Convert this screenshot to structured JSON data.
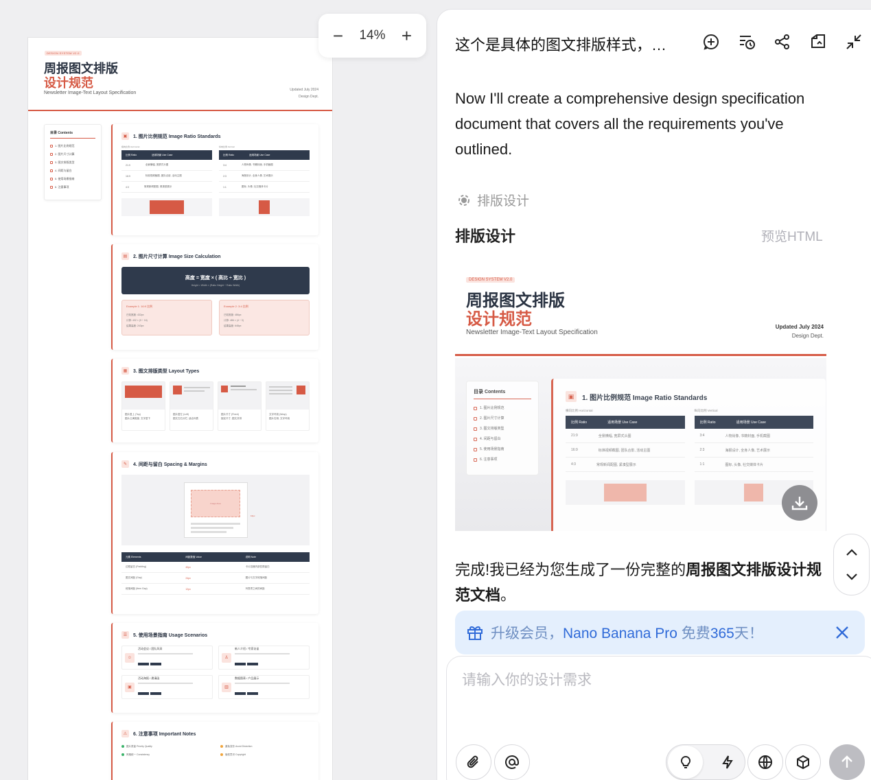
{
  "colors": {
    "accent": "#d65a45",
    "navy": "#2f3a4c",
    "link": "#2f6ad8"
  },
  "canvas": {
    "zoom": {
      "minus": "−",
      "value": "14%",
      "plus": "+"
    },
    "doc": {
      "badge": "DESIGN SYSTEM V2.0",
      "title_line1": "周报图文排版",
      "title_line2": "设计规范",
      "subtitle": "Newsletter Image-Text Layout Specification",
      "updated": "Updated July 2024",
      "dept": "Design Dept.",
      "toc_title": "目录 Contents",
      "toc_items": [
        "1. 图片比例规范",
        "2. 图片尺寸计算",
        "3. 图文排版类型",
        "4. 间距与留白",
        "5. 使用场景指南",
        "6. 注意事项"
      ],
      "sections": [
        {
          "title": "1. 图片比例规范 Image Ratio Standards",
          "icon": "image-icon"
        },
        {
          "title": "2. 图片尺寸计算 Image Size Calculation",
          "icon": "calculator-icon"
        },
        {
          "title": "3. 图文排版类型 Layout Types",
          "icon": "layout-icon"
        },
        {
          "title": "4. 间距与留白 Spacing & Margins",
          "icon": "ruler-icon"
        },
        {
          "title": "5. 使用场景指南 Usage Scenarios",
          "icon": "list-icon"
        },
        {
          "title": "6. 注意事项 Important Notes",
          "icon": "warning-icon"
        }
      ],
      "s1": {
        "h_caption": "横向比例 Horizontal",
        "v_caption": "纵向比例 Vertical",
        "col1": "比例 Ratio",
        "col2": "适用场景 Use Case",
        "h_rows": [
          [
            "21:9",
            "全景横幅, 宽屏式头图"
          ],
          [
            "16:9",
            "标准视频截图, 团队合影, 活动主图"
          ],
          [
            "4:3",
            "常规新闻配图, 紧凑型展示"
          ]
        ],
        "v_rows": [
          [
            "3:4",
            "人物肖像, 书籍封面, 手机截图"
          ],
          [
            "2:3",
            "海报设计, 全身人像, 艺术展示"
          ],
          [
            "1:1",
            "图标, 头像, 社交媒体卡片"
          ]
        ]
      },
      "s2": {
        "formula": "高度 = 宽度 × ( 高比 ÷ 宽比 )",
        "formula_hl": "高比 ÷ 宽比",
        "formula_en": "Height = Width × (Ratio Height ÷ Ratio Width)",
        "ex1_title": "Example 1: 16:9 比例",
        "ex1_lines": [
          "已知宽度: 432px",
          "计算: 432 × (9 ÷ 16)",
          "结果高度: 243px"
        ],
        "ex2_title": "Example 2: 3:4 比例",
        "ex2_lines": [
          "已知宽度: 486px",
          "计算: 486 × (4 ÷ 3)",
          "结果高度: 648px"
        ]
      },
      "s3": {
        "types": [
          {
            "name": "图片居上 (Top)",
            "desc": "图片占满宽度, 文字居下"
          },
          {
            "name": "图片居左 (Left)",
            "desc": "图文左右分栏, 适合列表"
          },
          {
            "name": "图片尺寸 (Fixed)",
            "desc": "固定尺寸, 图文并排"
          },
          {
            "name": "文字环绕 (Wrap)",
            "desc": "图片右侧, 文字环绕"
          }
        ]
      },
      "s4": {
        "image_area": "Image Area",
        "spacing_label": "16px",
        "cols": [
          "元素 Elements",
          "间距数值 Value",
          "说明 Note"
        ],
        "rows": [
          [
            "边框留白 (Padding)",
            "40px",
            "卡片容器内部四周留白"
          ],
          [
            "图文间距 (Gap)",
            "24px",
            "图片与文字段落间距"
          ],
          [
            "段落间距 (Item Gap)",
            "12px",
            "列表项之间的间距"
          ]
        ]
      },
      "s5": {
        "items": [
          {
            "title": "活动会议 / 团队风采",
            "icon": "people-icon"
          },
          {
            "title": "新人介绍 / 专家访谈",
            "icon": "user-icon"
          },
          {
            "title": "活动海报 / 邀请函",
            "icon": "poster-icon"
          },
          {
            "title": "数据图表 / 产品展示",
            "icon": "chart-icon"
          }
        ]
      },
      "s6": {
        "notes": [
          "图片质量 Priority Quality",
          "避免变形 Avoid Distortion",
          "风格统一 Consistency",
          "版权意识 Copyright"
        ]
      }
    }
  },
  "panel": {
    "title": "这个是具体的图文排版样式，…",
    "message": "Now I'll create a comprehensive design specification document that covers all the requirements you've outlined.",
    "step_label": "排版设计",
    "card_title": "排版设计",
    "preview_link": "预览HTML",
    "completion_pre": "完成!我已经为您生成了一份完整的",
    "completion_bold": "周报图文排版设计规范文档",
    "completion_post": "。",
    "promo_pre": "升级会员，",
    "promo_hl": "Nano Banana Pro",
    "promo_mid": " 免费",
    "promo_num": "365",
    "promo_post": "天！",
    "input_placeholder": "请输入你的设计需求"
  }
}
